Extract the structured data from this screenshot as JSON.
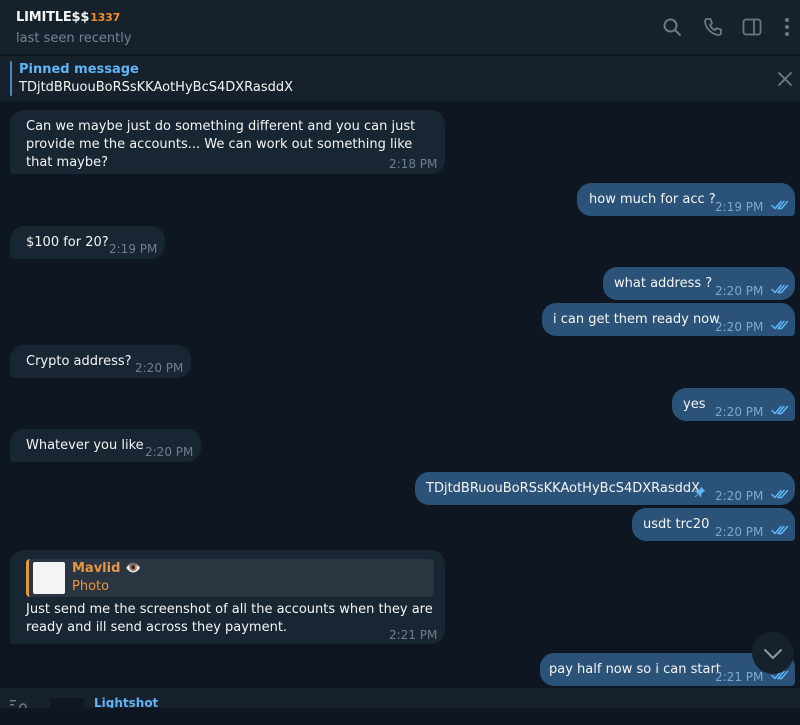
{
  "header": {
    "title": "LIMITLE$$",
    "title_badge": "1337",
    "status": "last seen recently",
    "icons": [
      "search-icon",
      "call-icon",
      "sidebar-icon",
      "more-icon"
    ]
  },
  "pinned": {
    "label": "Pinned message",
    "text": "TDjtdBRuouBoRSsKKAotHyBcS4DXRasddX"
  },
  "messages": [
    {
      "dir": "in",
      "text": "Can we maybe just do something different and you can just provide me the accounts... We can work out something like that maybe?",
      "time": "2:18 PM"
    },
    {
      "dir": "out",
      "text": "how much for acc ?",
      "time": "2:19 PM",
      "status": "read"
    },
    {
      "dir": "in",
      "text": "$100 for 20?",
      "time": "2:19 PM"
    },
    {
      "dir": "out",
      "text": "what address ?",
      "time": "2:20 PM",
      "status": "read"
    },
    {
      "dir": "out",
      "text": "i can get them ready now",
      "time": "2:20 PM",
      "status": "read"
    },
    {
      "dir": "in",
      "text": "Crypto address?",
      "time": "2:20 PM"
    },
    {
      "dir": "out",
      "text": "yes",
      "time": "2:20 PM",
      "status": "read"
    },
    {
      "dir": "in",
      "text": "Whatever you like",
      "time": "2:20 PM"
    },
    {
      "dir": "out",
      "text": "TDjtdBRuouBoRSsKKAotHyBcS4DXRasddX",
      "time": "2:20 PM",
      "status": "read",
      "pinned": true
    },
    {
      "dir": "out",
      "text": "usdt trc20",
      "time": "2:20 PM",
      "status": "read"
    },
    {
      "dir": "in",
      "reply_name": "Mavlid",
      "reply_emoji": "👁️",
      "reply_type": "Photo",
      "text": "Just send me the screenshot of all the accounts when they are ready and ill send across they payment.",
      "time": "2:21 PM"
    },
    {
      "dir": "out",
      "text": "pay half now so i can start",
      "time": "2:21 PM",
      "status": "read"
    }
  ],
  "footer": {
    "title": "Lightshot"
  },
  "colors": {
    "background": "#0e1621",
    "incoming_bubble": "#182533",
    "outgoing_bubble": "#2b5278",
    "accent": "#5eb5f7",
    "reply_accent": "#e69740"
  }
}
